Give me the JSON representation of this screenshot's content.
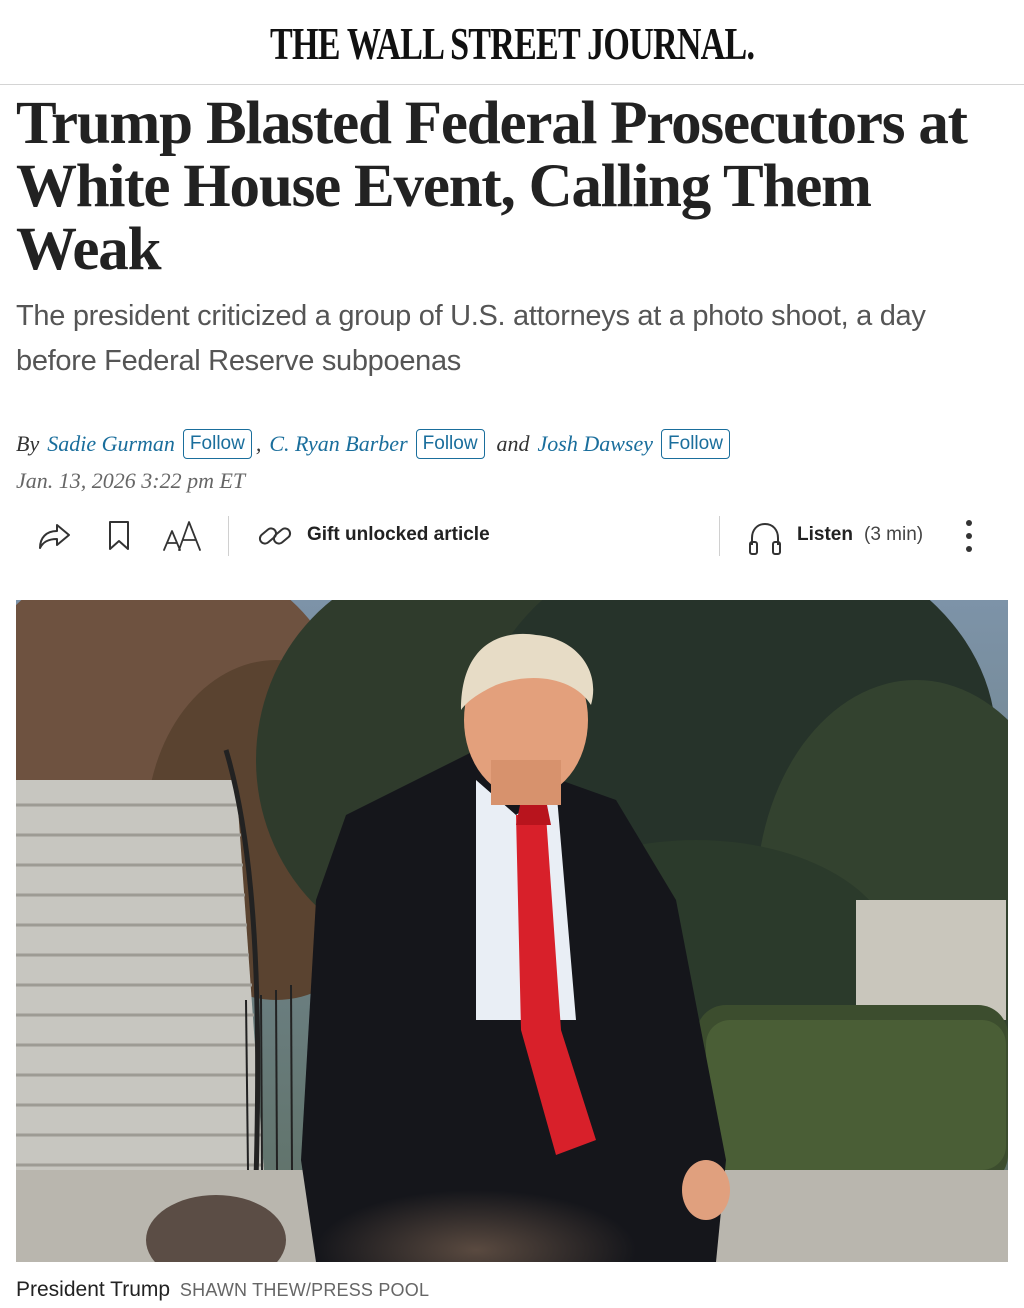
{
  "masthead": {
    "logo_text": "THE WALL STREET JOURNAL."
  },
  "article": {
    "headline": "Trump Blasted Federal Prosecutors at White House Event, Calling Them Weak",
    "dek": "The president criticized a group of U.S. attorneys at a photo shoot, a day before Federal Reserve subpoenas",
    "byline": {
      "prefix": "By",
      "authors": [
        "Sadie Gurman",
        "C. Ryan Barber",
        "Josh Dawsey"
      ],
      "separator_comma": ",",
      "separator_and": "and",
      "follow_label": "Follow"
    },
    "dateline": "Jan. 13, 2026 3:22 pm ET"
  },
  "toolbar": {
    "icons": [
      "share-icon",
      "bookmark-icon",
      "text-size-icon",
      "link-icon",
      "headphones-icon",
      "more-icon"
    ],
    "gift_label": "Gift unlocked article",
    "listen_label": "Listen",
    "listen_duration": "(3 min)"
  },
  "photo": {
    "caption": "President Trump",
    "credit": "SHAWN THEW/PRESS POOL"
  },
  "colors": {
    "link": "#1a6e9c",
    "text": "#222222",
    "tie_red": "#d8202a"
  }
}
